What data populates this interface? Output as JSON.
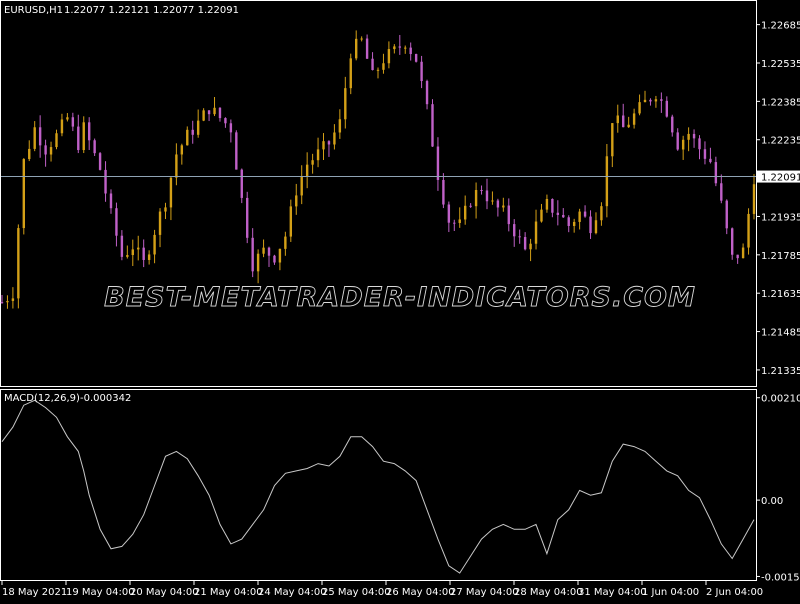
{
  "chart_header": {
    "symbol_label": "EURUSD,H1",
    "ohlc": "1.22077 1.22121 1.22077 1.22091"
  },
  "indicator_header": {
    "label": "MACD(12,26,9)",
    "value": "-0.000342"
  },
  "watermark": "BEST-METATRADER-INDICATORS.COM",
  "colors": {
    "background": "#000000",
    "bull_candle": "#d4a017",
    "bear_candle": "#c061c8",
    "price_line": "#8fa3b4",
    "macd_line": "#c8c8c8",
    "grid_frame": "#ffffff"
  },
  "chart_data": [
    {
      "type": "candlestick",
      "price_ticks": [
        "1.22685",
        "1.22535",
        "1.22385",
        "1.22235",
        "1.21935",
        "1.21785",
        "1.21635",
        "1.21485",
        "1.21335"
      ],
      "current_price_label": "1.22091",
      "current_price": 1.22091,
      "ylim": [
        1.2128,
        1.2275
      ],
      "time_ticks": [
        "18 May 2021",
        "19 May 04:00",
        "20 May 04:00",
        "21 May 04:00",
        "24 May 04:00",
        "25 May 04:00",
        "26 May 04:00",
        "27 May 04:00",
        "28 May 04:00",
        "31 May 04:00",
        "1 Jun 04:00",
        "2 Jun 04:00"
      ],
      "close_path": [
        [
          0,
          1.216
        ],
        [
          2,
          1.2164
        ],
        [
          4,
          1.2215
        ],
        [
          6,
          1.2228
        ],
        [
          8,
          1.222
        ],
        [
          10,
          1.2225
        ],
        [
          12,
          1.2232
        ],
        [
          14,
          1.2222
        ],
        [
          15,
          1.2228
        ],
        [
          18,
          1.2212
        ],
        [
          20,
          1.2194
        ],
        [
          22,
          1.2178
        ],
        [
          24,
          1.2182
        ],
        [
          26,
          1.2175
        ],
        [
          28,
          1.2188
        ],
        [
          30,
          1.22
        ],
        [
          32,
          1.2218
        ],
        [
          34,
          1.2225
        ],
        [
          36,
          1.223
        ],
        [
          38,
          1.2236
        ],
        [
          40,
          1.2232
        ],
        [
          42,
          1.2228
        ],
        [
          44,
          1.22
        ],
        [
          46,
          1.2175
        ],
        [
          48,
          1.218
        ],
        [
          50,
          1.2178
        ],
        [
          52,
          1.2186
        ],
        [
          54,
          1.2204
        ],
        [
          56,
          1.2214
        ],
        [
          58,
          1.2218
        ],
        [
          60,
          1.2222
        ],
        [
          62,
          1.223
        ],
        [
          64,
          1.2258
        ],
        [
          66,
          1.2262
        ],
        [
          68,
          1.2248
        ],
        [
          70,
          1.2255
        ],
        [
          72,
          1.2258
        ],
        [
          74,
          1.2262
        ],
        [
          76,
          1.2255
        ],
        [
          78,
          1.2235
        ],
        [
          80,
          1.221
        ],
        [
          82,
          1.2192
        ],
        [
          84,
          1.219
        ],
        [
          86,
          1.22
        ],
        [
          88,
          1.2205
        ],
        [
          90,
          1.2198
        ],
        [
          92,
          1.2195
        ],
        [
          94,
          1.2188
        ],
        [
          96,
          1.218
        ],
        [
          98,
          1.219
        ],
        [
          100,
          1.2198
        ],
        [
          102,
          1.2195
        ],
        [
          104,
          1.219
        ],
        [
          106,
          1.2195
        ],
        [
          108,
          1.219
        ],
        [
          110,
          1.22
        ],
        [
          112,
          1.2232
        ],
        [
          114,
          1.2228
        ],
        [
          116,
          1.2233
        ],
        [
          118,
          1.2238
        ],
        [
          120,
          1.2242
        ],
        [
          122,
          1.2235
        ],
        [
          124,
          1.2222
        ],
        [
          126,
          1.2226
        ],
        [
          128,
          1.222
        ],
        [
          130,
          1.2215
        ],
        [
          132,
          1.2198
        ],
        [
          134,
          1.2177
        ],
        [
          136,
          1.218
        ],
        [
          138,
          1.2209
        ]
      ]
    },
    {
      "type": "line",
      "name": "MACD(12,26,9)",
      "value_label": "-0.000342",
      "y_ticks": [
        "0.002103",
        "0.00",
        "-0.001568"
      ],
      "ylim": [
        -0.0016,
        0.0022
      ],
      "x": [
        0,
        2,
        4,
        6,
        8,
        10,
        12,
        14,
        15,
        16,
        18,
        20,
        22,
        24,
        26,
        28,
        30,
        32,
        34,
        36,
        38,
        40,
        42,
        44,
        46,
        48,
        50,
        52,
        54,
        56,
        58,
        60,
        62,
        64,
        66,
        68,
        70,
        72,
        74,
        76,
        78,
        80,
        82,
        84,
        86,
        88,
        90,
        92,
        94,
        96,
        98,
        100,
        102,
        104,
        106,
        108,
        110,
        112,
        114,
        116,
        118,
        120,
        122,
        124,
        126,
        128,
        130,
        132,
        134,
        136,
        138
      ],
      "values": [
        0.0012,
        0.0015,
        0.00195,
        0.00205,
        0.0019,
        0.0017,
        0.0013,
        0.001,
        0.0006,
        0.0001,
        -0.0006,
        -0.001,
        -0.00095,
        -0.0007,
        -0.0003,
        0.0003,
        0.0009,
        0.001,
        0.00085,
        0.0005,
        0.0001,
        -0.0005,
        -0.0009,
        -0.0008,
        -0.0005,
        -0.0002,
        0.0003,
        0.00055,
        0.0006,
        0.00065,
        0.00075,
        0.0007,
        0.0009,
        0.0013,
        0.0013,
        0.0011,
        0.0008,
        0.00075,
        0.0006,
        0.0004,
        -0.0002,
        -0.0008,
        -0.00135,
        -0.0015,
        -0.00115,
        -0.0008,
        -0.0006,
        -0.0005,
        -0.0006,
        -0.0006,
        -0.0005,
        -0.0011,
        -0.0004,
        -0.0002,
        0.0002,
        0.0001,
        0.00015,
        0.0008,
        0.00115,
        0.0011,
        0.001,
        0.0008,
        0.0006,
        0.0005,
        0.0002,
        5e-05,
        -0.0004,
        -0.0009,
        -0.0012,
        -0.0008,
        -0.0004
      ]
    }
  ]
}
